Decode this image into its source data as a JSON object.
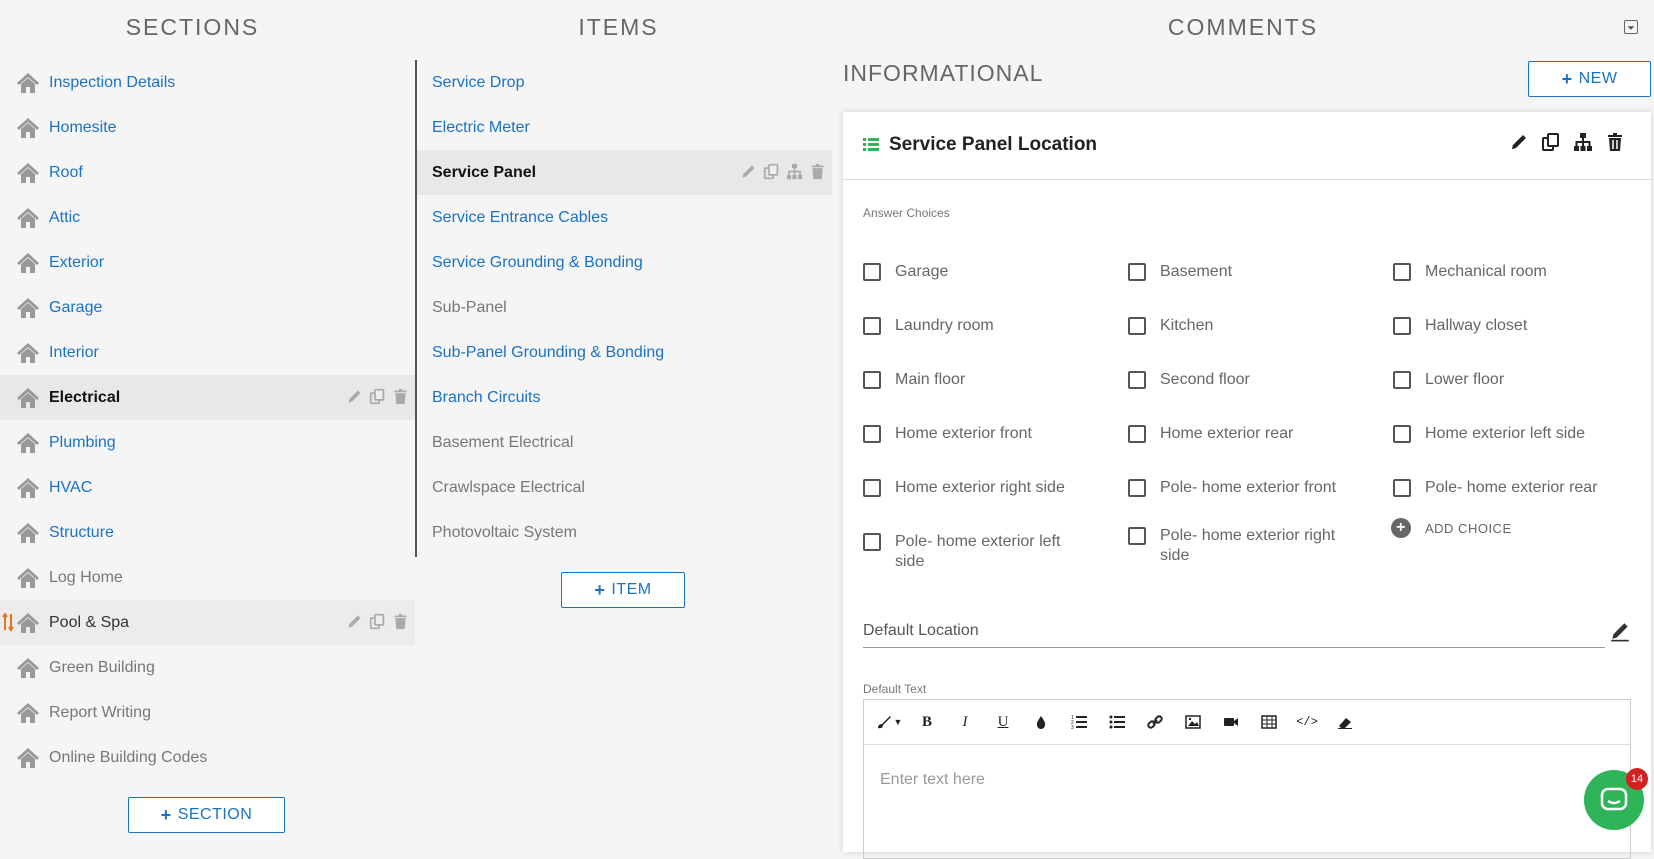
{
  "headers": {
    "sections": "SECTIONS",
    "items": "ITEMS",
    "comments": "COMMENTS"
  },
  "sections": [
    {
      "label": "Inspection Details",
      "state": "link"
    },
    {
      "label": "Homesite",
      "state": "link"
    },
    {
      "label": "Roof",
      "state": "link"
    },
    {
      "label": "Attic",
      "state": "link"
    },
    {
      "label": "Exterior",
      "state": "link"
    },
    {
      "label": "Garage",
      "state": "link"
    },
    {
      "label": "Interior",
      "state": "link"
    },
    {
      "label": "Electrical",
      "state": "active"
    },
    {
      "label": "Plumbing",
      "state": "link"
    },
    {
      "label": "HVAC",
      "state": "link"
    },
    {
      "label": "Structure",
      "state": "link"
    },
    {
      "label": "Log Home",
      "state": "grey"
    },
    {
      "label": "Pool & Spa",
      "state": "hover"
    },
    {
      "label": "Green Building",
      "state": "grey"
    },
    {
      "label": "Report Writing",
      "state": "grey"
    },
    {
      "label": "Online Building Codes",
      "state": "grey"
    }
  ],
  "add_section_label": "SECTION",
  "items": [
    {
      "label": "Service Drop",
      "state": "link"
    },
    {
      "label": "Electric Meter",
      "state": "link"
    },
    {
      "label": "Service Panel",
      "state": "active"
    },
    {
      "label": "Service Entrance Cables",
      "state": "link"
    },
    {
      "label": "Service Grounding & Bonding",
      "state": "link"
    },
    {
      "label": "Sub-Panel",
      "state": "grey"
    },
    {
      "label": "Sub-Panel Grounding & Bonding",
      "state": "link"
    },
    {
      "label": "Branch Circuits",
      "state": "link"
    },
    {
      "label": "Basement Electrical",
      "state": "grey"
    },
    {
      "label": "Crawlspace Electrical",
      "state": "grey"
    },
    {
      "label": "Photovoltaic System",
      "state": "grey"
    }
  ],
  "add_item_label": "ITEM",
  "comments": {
    "category": "INFORMATIONAL",
    "new_label": "NEW",
    "card_title": "Service Panel Location",
    "answer_choices_label": "Answer Choices",
    "choices_col1": [
      "Garage",
      "Laundry room",
      "Main floor",
      "Home exterior front",
      "Home exterior right side",
      "Pole- home exterior left side"
    ],
    "choices_col2": [
      "Basement",
      "Kitchen",
      "Second floor",
      "Home exterior rear",
      "Pole- home exterior front",
      "Pole- home exterior right side"
    ],
    "choices_col3": [
      "Mechanical room",
      "Hallway closet",
      "Lower floor",
      "Home exterior left side",
      "Pole- home exterior rear"
    ],
    "add_choice_label": "ADD CHOICE",
    "default_location_label": "Default Location",
    "default_text_label": "Default Text",
    "editor_placeholder": "Enter text here"
  },
  "chat_badge_count": "14",
  "colors": {
    "link": "#1a72c4",
    "chat": "#2fb45a",
    "badge": "#d42020",
    "list_icon": "#2fb45a"
  }
}
